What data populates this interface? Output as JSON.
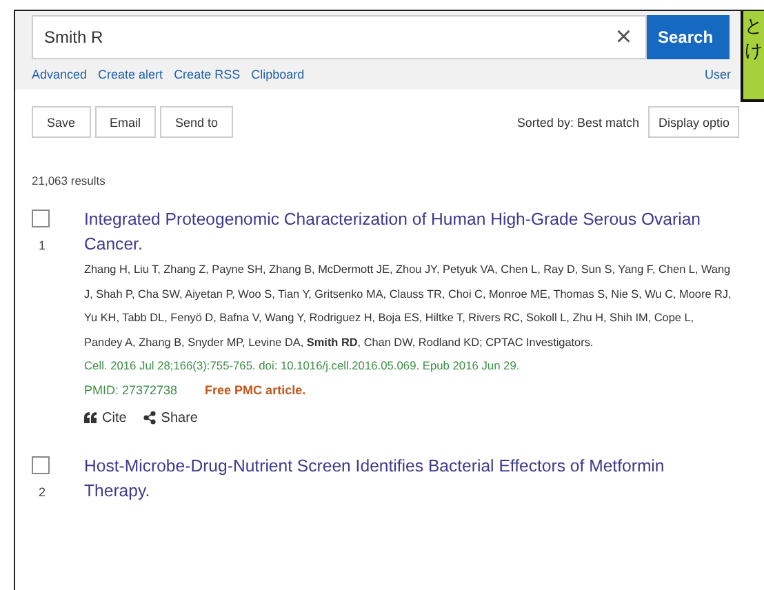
{
  "search": {
    "value": "Smith R",
    "clear": "×",
    "button": "Search"
  },
  "links": [
    "Advanced",
    "Create alert",
    "Create RSS",
    "Clipboard"
  ],
  "user_link": "User",
  "note": {
    "lines": [
      "と",
      "け"
    ]
  },
  "actions": [
    "Save",
    "Email",
    "Send to"
  ],
  "sort": "Sorted by: Best match",
  "display_button": "Display optio",
  "count": "21,063 results",
  "results": [
    {
      "number": "1",
      "checked": false,
      "title": "Integrated Proteogenomic Characterization of Human High-Grade Serous Ovarian Cancer.",
      "authors": "Zhang H, Liu T, Zhang Z, Payne SH, Zhang B, McDermott JE, Zhou JY, Petyuk VA, Chen L, Ray D, Sun S, Yang F, Chen L, Wang J, Shah P, Cha SW, Aiyetan P, Woo S, Tian Y, Gritsenko MA, Clauss TR, Choi C, Monroe ME, Thomas S, Nie S, Wu C, Moore RJ, Yu KH, Tabb DL, Fenyö D, Bafna V, Wang Y, Rodriguez H, Boja ES, Hiltke T, Rivers RC, Sokoll L, Zhu H, Shih IM, Cope L, Pandey A, Zhang B, Snyder MP, Levine DA, **Smith RD**, Chan DW, Rodland KD; CPTAC Investigators.",
      "citation": "Cell. 2016 Jul 28;166(3):755-765. doi: 10.1016/j.cell.2016.05.069. Epub 2016 Jun 29.",
      "pmid": "PMID: 27372738",
      "free": "Free PMC article.",
      "cite": "Cite",
      "share": "Share"
    },
    {
      "number": "2",
      "checked": false,
      "title": "Host-Microbe-Drug-Nutrient Screen Identifies Bacterial Effectors of Metformin Therapy."
    }
  ]
}
